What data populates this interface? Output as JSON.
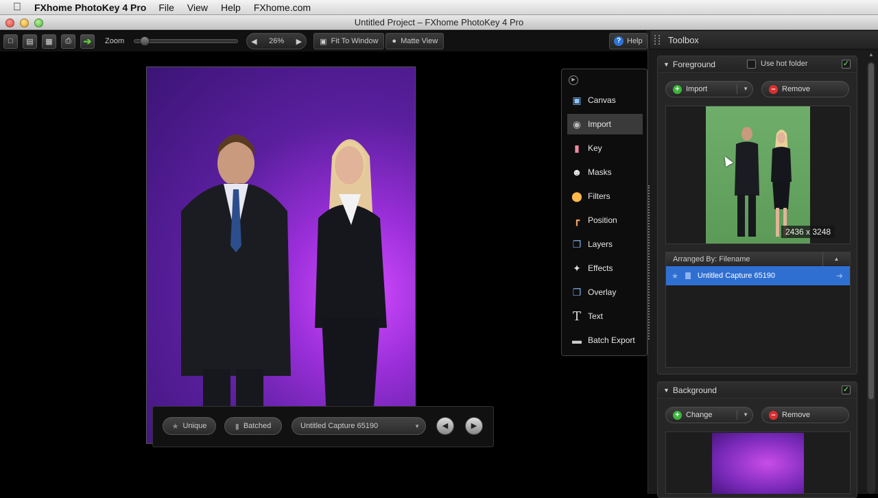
{
  "menubar": {
    "app_name": "FXhome PhotoKey 4 Pro",
    "items": [
      "File",
      "View",
      "Help",
      "FXhome.com"
    ]
  },
  "window": {
    "title": "Untitled Project – FXhome PhotoKey 4 Pro"
  },
  "toolbar": {
    "zoom_label": "Zoom",
    "zoom_value": "26%",
    "fit_to_window": "Fit To Window",
    "matte_view": "Matte View",
    "help": "Help"
  },
  "tool_menu": {
    "items": [
      {
        "label": "Canvas",
        "icon": "canvas-icon"
      },
      {
        "label": "Import",
        "icon": "camera-icon"
      },
      {
        "label": "Key",
        "icon": "eraser-icon"
      },
      {
        "label": "Masks",
        "icon": "mask-icon"
      },
      {
        "label": "Filters",
        "icon": "color-wheel-icon"
      },
      {
        "label": "Position",
        "icon": "position-icon"
      },
      {
        "label": "Layers",
        "icon": "layers-icon"
      },
      {
        "label": "Effects",
        "icon": "sparkle-icon"
      },
      {
        "label": "Overlay",
        "icon": "overlay-icon"
      },
      {
        "label": "Text",
        "icon": "text-icon"
      },
      {
        "label": "Batch Export",
        "icon": "drive-icon"
      }
    ],
    "active": "Import"
  },
  "bottom_bar": {
    "unique": "Unique",
    "batched": "Batched",
    "capture_select": "Untitled Capture 65190"
  },
  "toolbox": {
    "title": "Toolbox",
    "foreground": {
      "title": "Foreground",
      "use_hot_folder": "Use hot folder",
      "import": "Import",
      "remove": "Remove",
      "dimensions": "2436 x 3248",
      "arranged_by": "Arranged By: Filename",
      "items": [
        "Untitled Capture 65190"
      ]
    },
    "background": {
      "title": "Background",
      "change": "Change",
      "remove": "Remove"
    }
  }
}
